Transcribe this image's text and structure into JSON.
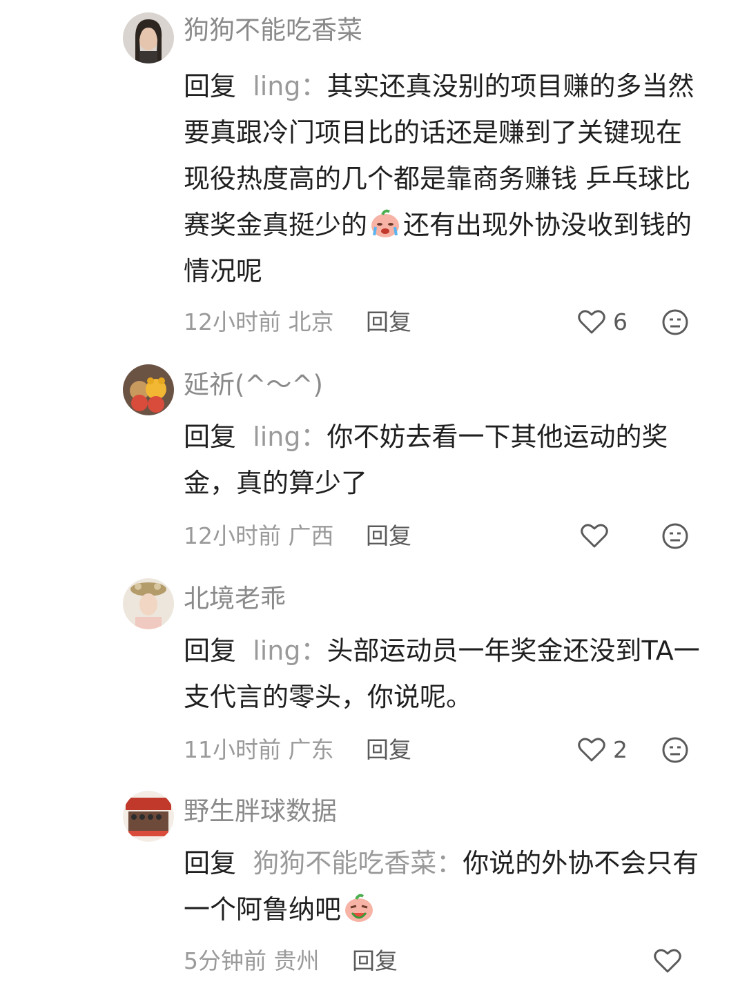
{
  "comments": [
    {
      "username": "狗狗不能吃香菜",
      "reply_word": "回复",
      "mention": "ling：",
      "text_before_emoji": "其实还真没别的项目赚的多当然要真跟冷门项目比的话还是赚到了关键现在现役热度高的几个都是靠商务赚钱 乒乓球比赛奖金真挺少的",
      "emoji": "crying-face-emoji",
      "text_after_emoji": "还有出现外协没收到钱的情况呢",
      "time_location": "12小时前 北京",
      "reply_label": "回复",
      "like_count": "6",
      "like_icon": "heart-outline-icon",
      "more_icon": "neutral-face-icon"
    },
    {
      "username": "延祈(^～^)",
      "reply_word": "回复",
      "mention": "ling：",
      "text_before_emoji": "你不妨去看一下其他运动的奖金，真的算少了",
      "time_location": "12小时前 广西",
      "reply_label": "回复",
      "like_count": "",
      "like_icon": "heart-outline-icon",
      "more_icon": "neutral-face-icon"
    },
    {
      "username": "北境老乖",
      "reply_word": "回复",
      "mention": "ling：",
      "text_before_emoji": "头部运动员一年奖金还没到TA一支代言的零头，你说呢。",
      "time_location": "11小时前 广东",
      "reply_label": "回复",
      "like_count": "2",
      "like_icon": "heart-outline-icon",
      "more_icon": "neutral-face-icon"
    },
    {
      "username": "野生胖球数据",
      "reply_word": "回复",
      "mention": "狗狗不能吃香菜：",
      "text_before_emoji": "你说的外协不会只有一个阿鲁纳吧",
      "emoji": "eating-watermelon-emoji",
      "time_location": "5分钟前 贵州",
      "reply_label": "回复",
      "like_count": "",
      "like_icon": "heart-outline-icon"
    }
  ]
}
